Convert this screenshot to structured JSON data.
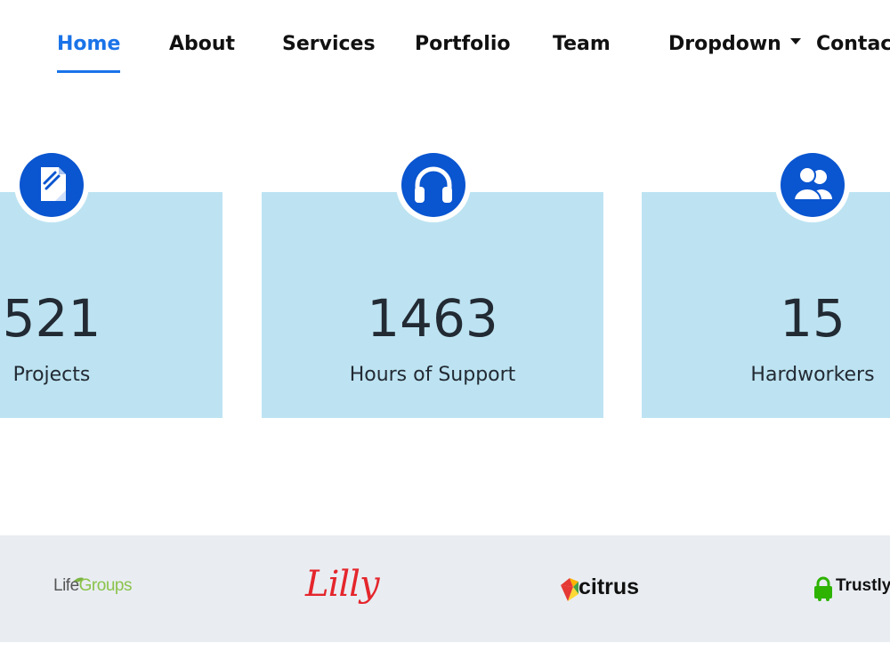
{
  "nav": {
    "items": [
      {
        "label": "Home",
        "active": true
      },
      {
        "label": "About"
      },
      {
        "label": "Services"
      },
      {
        "label": "Portfolio"
      },
      {
        "label": "Team"
      },
      {
        "label": "Dropdown",
        "has_caret": true
      },
      {
        "label": "Contact"
      }
    ],
    "accent_color": "#1a73e8"
  },
  "stats": [
    {
      "value": "521",
      "label": "Projects",
      "icon": "document-icon"
    },
    {
      "value": "1463",
      "label": "Hours of Support",
      "icon": "headphones-icon"
    },
    {
      "value": "15",
      "label": "Hardworkers",
      "icon": "users-icon"
    }
  ],
  "stats_style": {
    "card_color": "#bde3f2",
    "icon_color": "#0a55d0"
  },
  "clients": {
    "background": "#e9edf2",
    "logos": [
      {
        "name": "LifeGroups",
        "part1": "Life",
        "part2": "Groups"
      },
      {
        "name": "Lilly",
        "text": "Lilly"
      },
      {
        "name": "citrus",
        "text": "citrus"
      },
      {
        "name": "Trustly",
        "text": "Trustly"
      }
    ]
  }
}
